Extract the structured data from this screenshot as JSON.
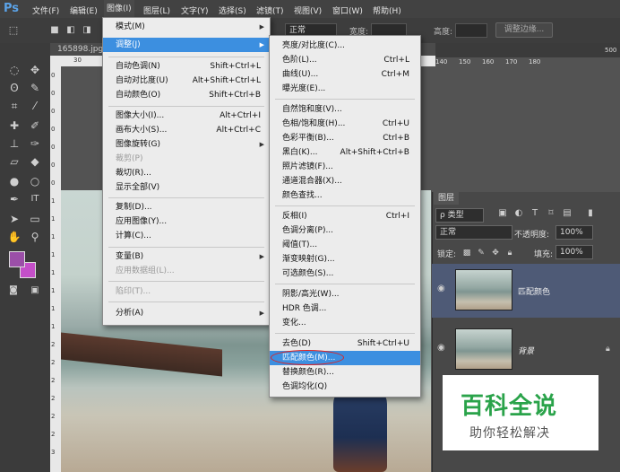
{
  "menubar": {
    "logo": "Ps",
    "items": [
      "文件(F)",
      "编辑(E)",
      "图像(I)",
      "图层(L)",
      "文字(Y)",
      "选择(S)",
      "滤镜(T)",
      "视图(V)",
      "窗口(W)",
      "帮助(H)"
    ]
  },
  "options": {
    "mode_label": "正常",
    "width_label": "宽度:",
    "height_label": "高度:",
    "edge_button": "调整边缘..."
  },
  "document": {
    "tab_title": "165898.jpg",
    "ruler_h": [
      "30",
      "140",
      "150",
      "160",
      "170",
      "180",
      "500"
    ],
    "ruler_v": [
      "0",
      "0",
      "0",
      "0",
      "0",
      "0",
      "0",
      "1",
      "1",
      "1",
      "1",
      "1",
      "1",
      "1",
      "1",
      "2",
      "2",
      "2",
      "2",
      "2",
      "2",
      "3"
    ]
  },
  "layers_panel": {
    "tab": "图层",
    "filter_label": "ρ 类型",
    "blend_mode": "正常",
    "opacity_label": "不透明度:",
    "opacity_value": "100%",
    "lock_label": "锁定:",
    "fill_label": "填充:",
    "fill_value": "100%",
    "layers": [
      {
        "name": "匹配颜色"
      },
      {
        "name": "背景"
      }
    ]
  },
  "image_menu": {
    "items": [
      {
        "label": "模式(M)",
        "shortcut": "",
        "submenu": true
      },
      {
        "label": "调整(J)",
        "shortcut": "",
        "submenu": true,
        "highlighted": true
      },
      {
        "label": "自动色调(N)",
        "shortcut": "Shift+Ctrl+L"
      },
      {
        "label": "自动对比度(U)",
        "shortcut": "Alt+Shift+Ctrl+L"
      },
      {
        "label": "自动颜色(O)",
        "shortcut": "Shift+Ctrl+B"
      },
      {
        "label": "图像大小(I)...",
        "shortcut": "Alt+Ctrl+I"
      },
      {
        "label": "画布大小(S)...",
        "shortcut": "Alt+Ctrl+C"
      },
      {
        "label": "图像旋转(G)",
        "shortcut": "",
        "submenu": true
      },
      {
        "label": "裁剪(P)",
        "shortcut": "",
        "disabled": true
      },
      {
        "label": "裁切(R)...",
        "shortcut": ""
      },
      {
        "label": "显示全部(V)",
        "shortcut": ""
      },
      {
        "label": "复制(D)...",
        "shortcut": ""
      },
      {
        "label": "应用图像(Y)...",
        "shortcut": ""
      },
      {
        "label": "计算(C)...",
        "shortcut": ""
      },
      {
        "label": "变量(B)",
        "shortcut": "",
        "submenu": true
      },
      {
        "label": "应用数据组(L)...",
        "shortcut": "",
        "disabled": true
      },
      {
        "label": "陷印(T)...",
        "shortcut": "",
        "disabled": true
      },
      {
        "label": "分析(A)",
        "shortcut": "",
        "submenu": true
      }
    ]
  },
  "adjust_menu": {
    "items": [
      {
        "label": "亮度/对比度(C)...",
        "shortcut": ""
      },
      {
        "label": "色阶(L)...",
        "shortcut": "Ctrl+L"
      },
      {
        "label": "曲线(U)...",
        "shortcut": "Ctrl+M"
      },
      {
        "label": "曝光度(E)...",
        "shortcut": ""
      },
      {
        "label": "自然饱和度(V)...",
        "shortcut": ""
      },
      {
        "label": "色相/饱和度(H)...",
        "shortcut": "Ctrl+U"
      },
      {
        "label": "色彩平衡(B)...",
        "shortcut": "Ctrl+B"
      },
      {
        "label": "黑白(K)...",
        "shortcut": "Alt+Shift+Ctrl+B"
      },
      {
        "label": "照片滤镜(F)...",
        "shortcut": ""
      },
      {
        "label": "通道混合器(X)...",
        "shortcut": ""
      },
      {
        "label": "颜色查找...",
        "shortcut": ""
      },
      {
        "label": "反相(I)",
        "shortcut": "Ctrl+I"
      },
      {
        "label": "色调分离(P)...",
        "shortcut": ""
      },
      {
        "label": "阈值(T)...",
        "shortcut": ""
      },
      {
        "label": "渐变映射(G)...",
        "shortcut": ""
      },
      {
        "label": "可选颜色(S)...",
        "shortcut": ""
      },
      {
        "label": "阴影/高光(W)...",
        "shortcut": ""
      },
      {
        "label": "HDR 色调...",
        "shortcut": ""
      },
      {
        "label": "变化...",
        "shortcut": ""
      },
      {
        "label": "去色(D)",
        "shortcut": "Shift+Ctrl+U"
      },
      {
        "label": "匹配颜色(M)...",
        "shortcut": "",
        "highlighted": true
      },
      {
        "label": "替换颜色(R)...",
        "shortcut": ""
      },
      {
        "label": "色调均化(Q)",
        "shortcut": ""
      }
    ]
  },
  "watermark": {
    "title": "百科全说",
    "subtitle": "助你轻松解决"
  },
  "colors": {
    "menu_highlight": "#3c8fe0",
    "watermark_green": "#2aa34a",
    "foreground_swatch": "#9b4fa8",
    "background_swatch": "#c44fc9"
  }
}
